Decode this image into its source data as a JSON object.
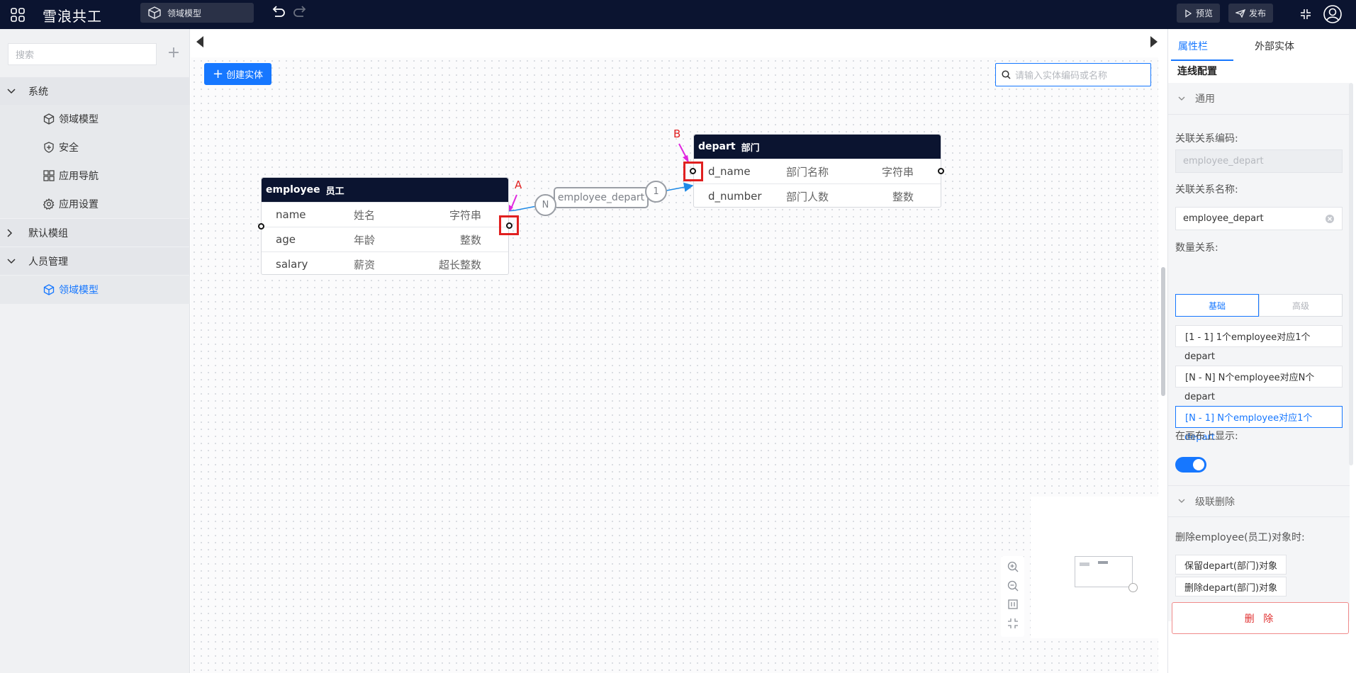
{
  "app": {
    "title": "雪浪共工"
  },
  "breadcrumb": {
    "label": "领域模型"
  },
  "toolbar": {
    "preview": "预览",
    "publish": "发布"
  },
  "sidebar": {
    "search_placeholder": "搜索",
    "groups": [
      {
        "label": "系统",
        "items": [
          "领域模型",
          "安全",
          "应用导航",
          "应用设置"
        ]
      },
      {
        "label": "默认模组"
      },
      {
        "label": "人员管理",
        "items": [
          "领域模型"
        ]
      }
    ]
  },
  "canvas": {
    "create_label": "创建实体",
    "search_placeholder": "请输入实体编码或名称",
    "entities": [
      {
        "code": "employee",
        "name": "员工",
        "fields": [
          {
            "code": "name",
            "name": "姓名",
            "type": "字符串"
          },
          {
            "code": "age",
            "name": "年龄",
            "type": "整数"
          },
          {
            "code": "salary",
            "name": "薪资",
            "type": "超长整数"
          }
        ]
      },
      {
        "code": "depart",
        "name": "部门",
        "fields": [
          {
            "code": "d_name",
            "name": "部门名称",
            "type": "字符串"
          },
          {
            "code": "d_number",
            "name": "部门人数",
            "type": "整数"
          }
        ]
      }
    ],
    "relation": {
      "label": "employee_depart",
      "source_card": "N",
      "target_card": "1"
    },
    "markers": {
      "a": "A",
      "b": "B"
    }
  },
  "panel": {
    "tabs": [
      "属性栏",
      "外部实体"
    ],
    "subtab": "连线配置",
    "general": {
      "title": "通用",
      "code_label": "关联关系编码:",
      "code_value": "employee_depart",
      "name_label": "关联关系名称:",
      "name_value": "employee_depart",
      "count_label": "数量关系:",
      "seg_basic": "基础",
      "seg_advanced": "高级",
      "options": [
        {
          "line1": "[1 - 1] 1个employee对应1个",
          "line2": "depart"
        },
        {
          "line1": "[N - N] N个employee对应N个",
          "line2": "depart"
        },
        {
          "line1": "[N - 1] N个employee对应1个",
          "line2": "depart"
        }
      ],
      "show_label": "在画布上显示:",
      "show_enabled": true
    },
    "cascade": {
      "title": "级联删除",
      "desc": "删除employee(员工)对象时:",
      "keep": "保留depart(部门)对象",
      "delete": "删除depart(部门)对象"
    },
    "delete_button": "删 除"
  }
}
